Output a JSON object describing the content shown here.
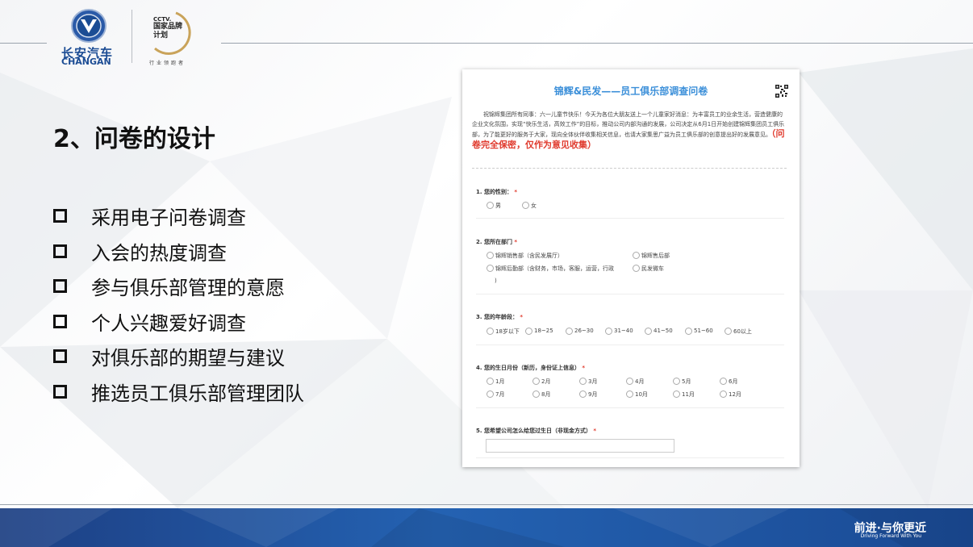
{
  "brand": {
    "logo_cn": "长安汽车",
    "logo_en": "CHANGAN",
    "colors": {
      "brand_blue": "#1b4c94",
      "accent_blue": "#3b8fd9",
      "red": "#e03b2e"
    }
  },
  "cctv": {
    "line1": "CCTV.",
    "line2": "国家品牌计划",
    "sub": "行业领跑者"
  },
  "slide": {
    "title": "2、问卷的设计",
    "bullets": [
      "采用电子问卷调查",
      "入会的热度调查",
      "参与俱乐部管理的意愿",
      "个人兴趣爱好调查",
      "对俱乐部的期望与建议",
      "推选员工俱乐部管理团队"
    ]
  },
  "survey": {
    "title": "锦辉&民发——员工俱乐部调查问卷",
    "intro": "祝锦辉集团所有同事：六一儿童节快乐！今天为各位大朋友送上一个儿童家好消息：为丰富员工的业余生活，营造健康的企业文化氛围，实现“快乐生活，高效工作”的目标，推动公司内部沟通的发展，公司决定从6月1日开始创建锦辉集团员工俱乐部，为了能更好的服务于大家，现向全体伙伴收集相关信息，也请大家集思广益为员工俱乐部的创意提出好的发展意见。",
    "intro_highlight": "（问卷完全保密，仅作为意见收集）",
    "q1": {
      "label": "1.  您的性别：",
      "options": [
        "男",
        "女"
      ]
    },
    "q2": {
      "label": "2.  您所在部门",
      "options": [
        "锦辉销售部（含民发展厅）",
        "锦辉售后部",
        "锦辉后勤部（含财务，市场，客服，运营，行政",
        "民发微车"
      ],
      "wrap": ")"
    },
    "q3": {
      "label": "3.  您的年龄段：",
      "options": [
        "18岁以下",
        "18~25",
        "26~30",
        "31~40",
        "41~50",
        "51~60",
        "60以上"
      ]
    },
    "q4": {
      "label": "4.  您的生日月份（新历，身份证上信息）",
      "options": [
        "1月",
        "2月",
        "3月",
        "4月",
        "5月",
        "6月",
        "7月",
        "8月",
        "9月",
        "10月",
        "11月",
        "12月"
      ]
    },
    "q5": {
      "label": "5.  您希望公司怎么给您过生日（非现金方式）"
    },
    "required": "*"
  },
  "footer": {
    "slogan": "前进·与你更近",
    "slogan_en": "Driving Forward With You"
  }
}
